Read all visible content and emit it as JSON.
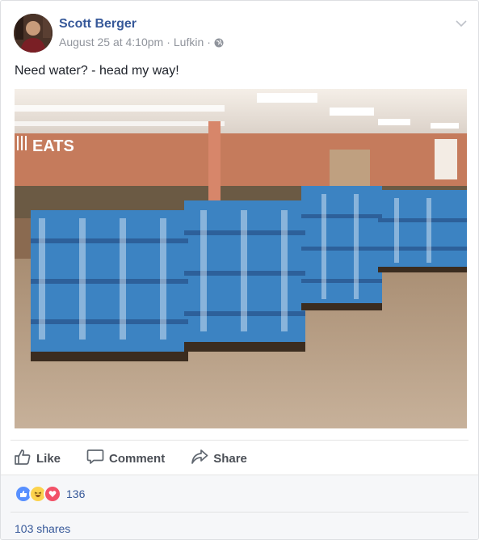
{
  "post": {
    "author": "Scott Berger",
    "date": "August 25 at 4:10pm",
    "separator": "·",
    "location": "Lufkin",
    "text": "Need water? - head my way!",
    "photo": {
      "sign_text": "EATS",
      "sign_icon": "utensils-icon"
    }
  },
  "actions": {
    "like": "Like",
    "comment": "Comment",
    "share": "Share"
  },
  "reactions": {
    "types": [
      "like",
      "haha",
      "love"
    ],
    "count": "136"
  },
  "shares": "103 shares",
  "colors": {
    "link": "#365899",
    "meta": "#90949c",
    "action": "#4b4f56",
    "like_blue": "#5890ff",
    "love_red": "#f25268",
    "haha_yellow": "#fcd34d"
  }
}
